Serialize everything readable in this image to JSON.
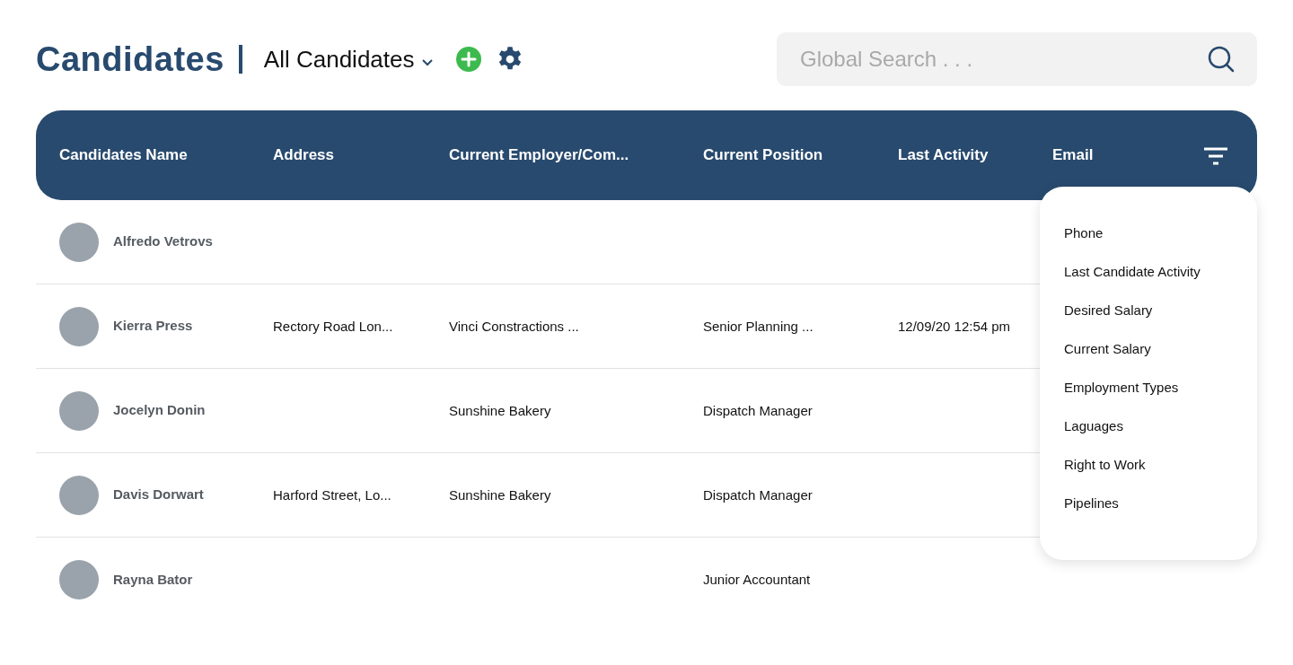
{
  "title": "Candidates",
  "view_selector": {
    "label": "All Candidates"
  },
  "search": {
    "placeholder": "Global Search . . ."
  },
  "table": {
    "columns": [
      "Candidates Name",
      "Address",
      "Current Employer/Com...",
      "Current Position",
      "Last Activity",
      "Email"
    ],
    "rows": [
      {
        "cells": [
          "Alfredo Vetrovs"
        ]
      },
      {
        "cells": [
          "Kierra Press",
          "Rectory Road Lon...",
          "Vinci Constractions ...",
          "Senior Planning ...",
          "12/09/20 12:54 pm"
        ]
      },
      {
        "cells": [
          "Jocelyn Donin",
          "",
          "Sunshine Bakery",
          "Dispatch Manager"
        ]
      },
      {
        "cells": [
          "Davis Dorwart",
          "Harford Street, Lo...",
          "Sunshine Bakery",
          "Dispatch Manager"
        ]
      },
      {
        "cells": [
          "Rayna Bator",
          "",
          "",
          "Junior Accountant"
        ]
      }
    ]
  },
  "column_menu": {
    "items": [
      "Phone",
      "Last Candidate Activity",
      "Desired Salary",
      "Current Salary",
      "Employment Types",
      "Laguages",
      "Right to Work",
      "Pipelines"
    ]
  }
}
